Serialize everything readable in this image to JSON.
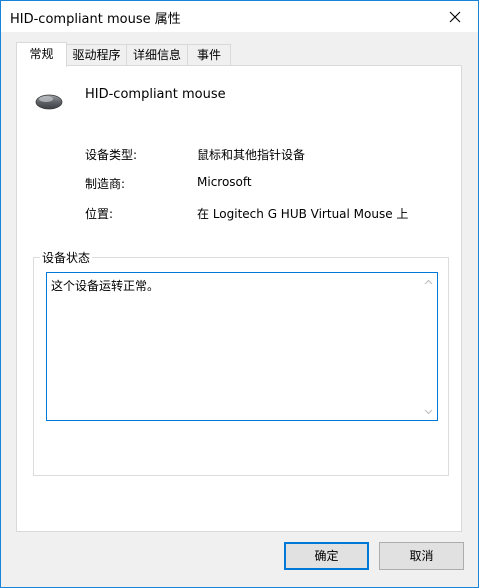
{
  "window": {
    "title": "HID-compliant mouse 属性"
  },
  "tabs": [
    {
      "label": "常规",
      "active": true
    },
    {
      "label": "驱动程序",
      "active": false
    },
    {
      "label": "详细信息",
      "active": false
    },
    {
      "label": "事件",
      "active": false
    }
  ],
  "device": {
    "icon": "mouse-icon",
    "name": "HID-compliant mouse"
  },
  "properties": {
    "type_label": "设备类型:",
    "type_value": "鼠标和其他指针设备",
    "manufacturer_label": "制造商:",
    "manufacturer_value": "Microsoft",
    "location_label": "位置:",
    "location_value": "在 Logitech G HUB Virtual Mouse 上"
  },
  "status": {
    "group_title": "设备状态",
    "text": "这个设备运转正常。"
  },
  "buttons": {
    "ok": "确定",
    "cancel": "取消"
  },
  "colors": {
    "accent": "#0078d7",
    "window_border": "#1883d7"
  }
}
